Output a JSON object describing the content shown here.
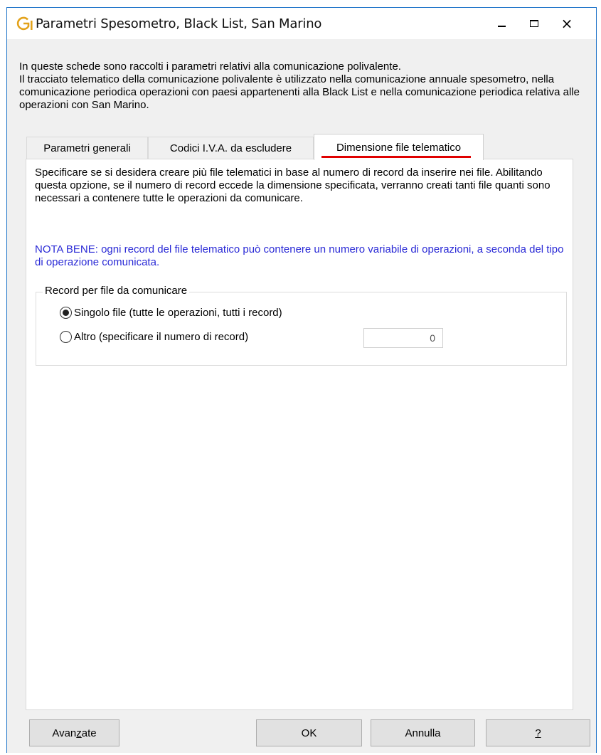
{
  "window": {
    "title": "Parametri Spesometro, Black List, San Marino",
    "logo_letter": "G",
    "controls": {
      "minimize": "minimize",
      "maximize": "maximize",
      "close": "×"
    }
  },
  "intro": {
    "line1": "In queste schede sono raccolti i parametri relativi alla comunicazione polivalente.",
    "line2": "Il tracciato telematico della comunicazione polivalente è utilizzato nella comunicazione annuale spesometro, nella comunicazione periodica operazioni con paesi appartenenti alla Black List e nella comunicazione periodica relativa alle operazioni con San Marino."
  },
  "tabs": [
    {
      "label": "Parametri generali",
      "active": false
    },
    {
      "label": "Codici I.V.A. da escludere",
      "active": false
    },
    {
      "label": "Dimensione file telematico",
      "active": true
    }
  ],
  "panel": {
    "description": "Specificare se si desidera creare più file telematici in base al numero di record da inserire nei file. Abilitando questa opzione, se il numero di record eccede la dimensione specificata, verranno creati tanti file quanti sono necessari a contenere tutte le operazioni da comunicare.",
    "note": "NOTA BENE: ogni record del file telematico può contenere un numero variabile di operazioni, a seconda del tipo di operazione comunicata.",
    "group_title": "Record per file da comunicare",
    "option_single": "Singolo file (tutte le operazioni, tutti i record)",
    "option_other": "Altro (specificare il numero di record)",
    "selected_option": "single",
    "record_count": "0"
  },
  "buttons": {
    "advanced_prefix": "Avan",
    "advanced_underlined": "z",
    "advanced_suffix": "ate",
    "ok": "OK",
    "cancel": "Annulla",
    "help": "?"
  },
  "colors": {
    "accent_underline": "#e00000",
    "note_text": "#2a2ad6",
    "window_border": "#1e73c9",
    "logo": "#e3a21a"
  }
}
